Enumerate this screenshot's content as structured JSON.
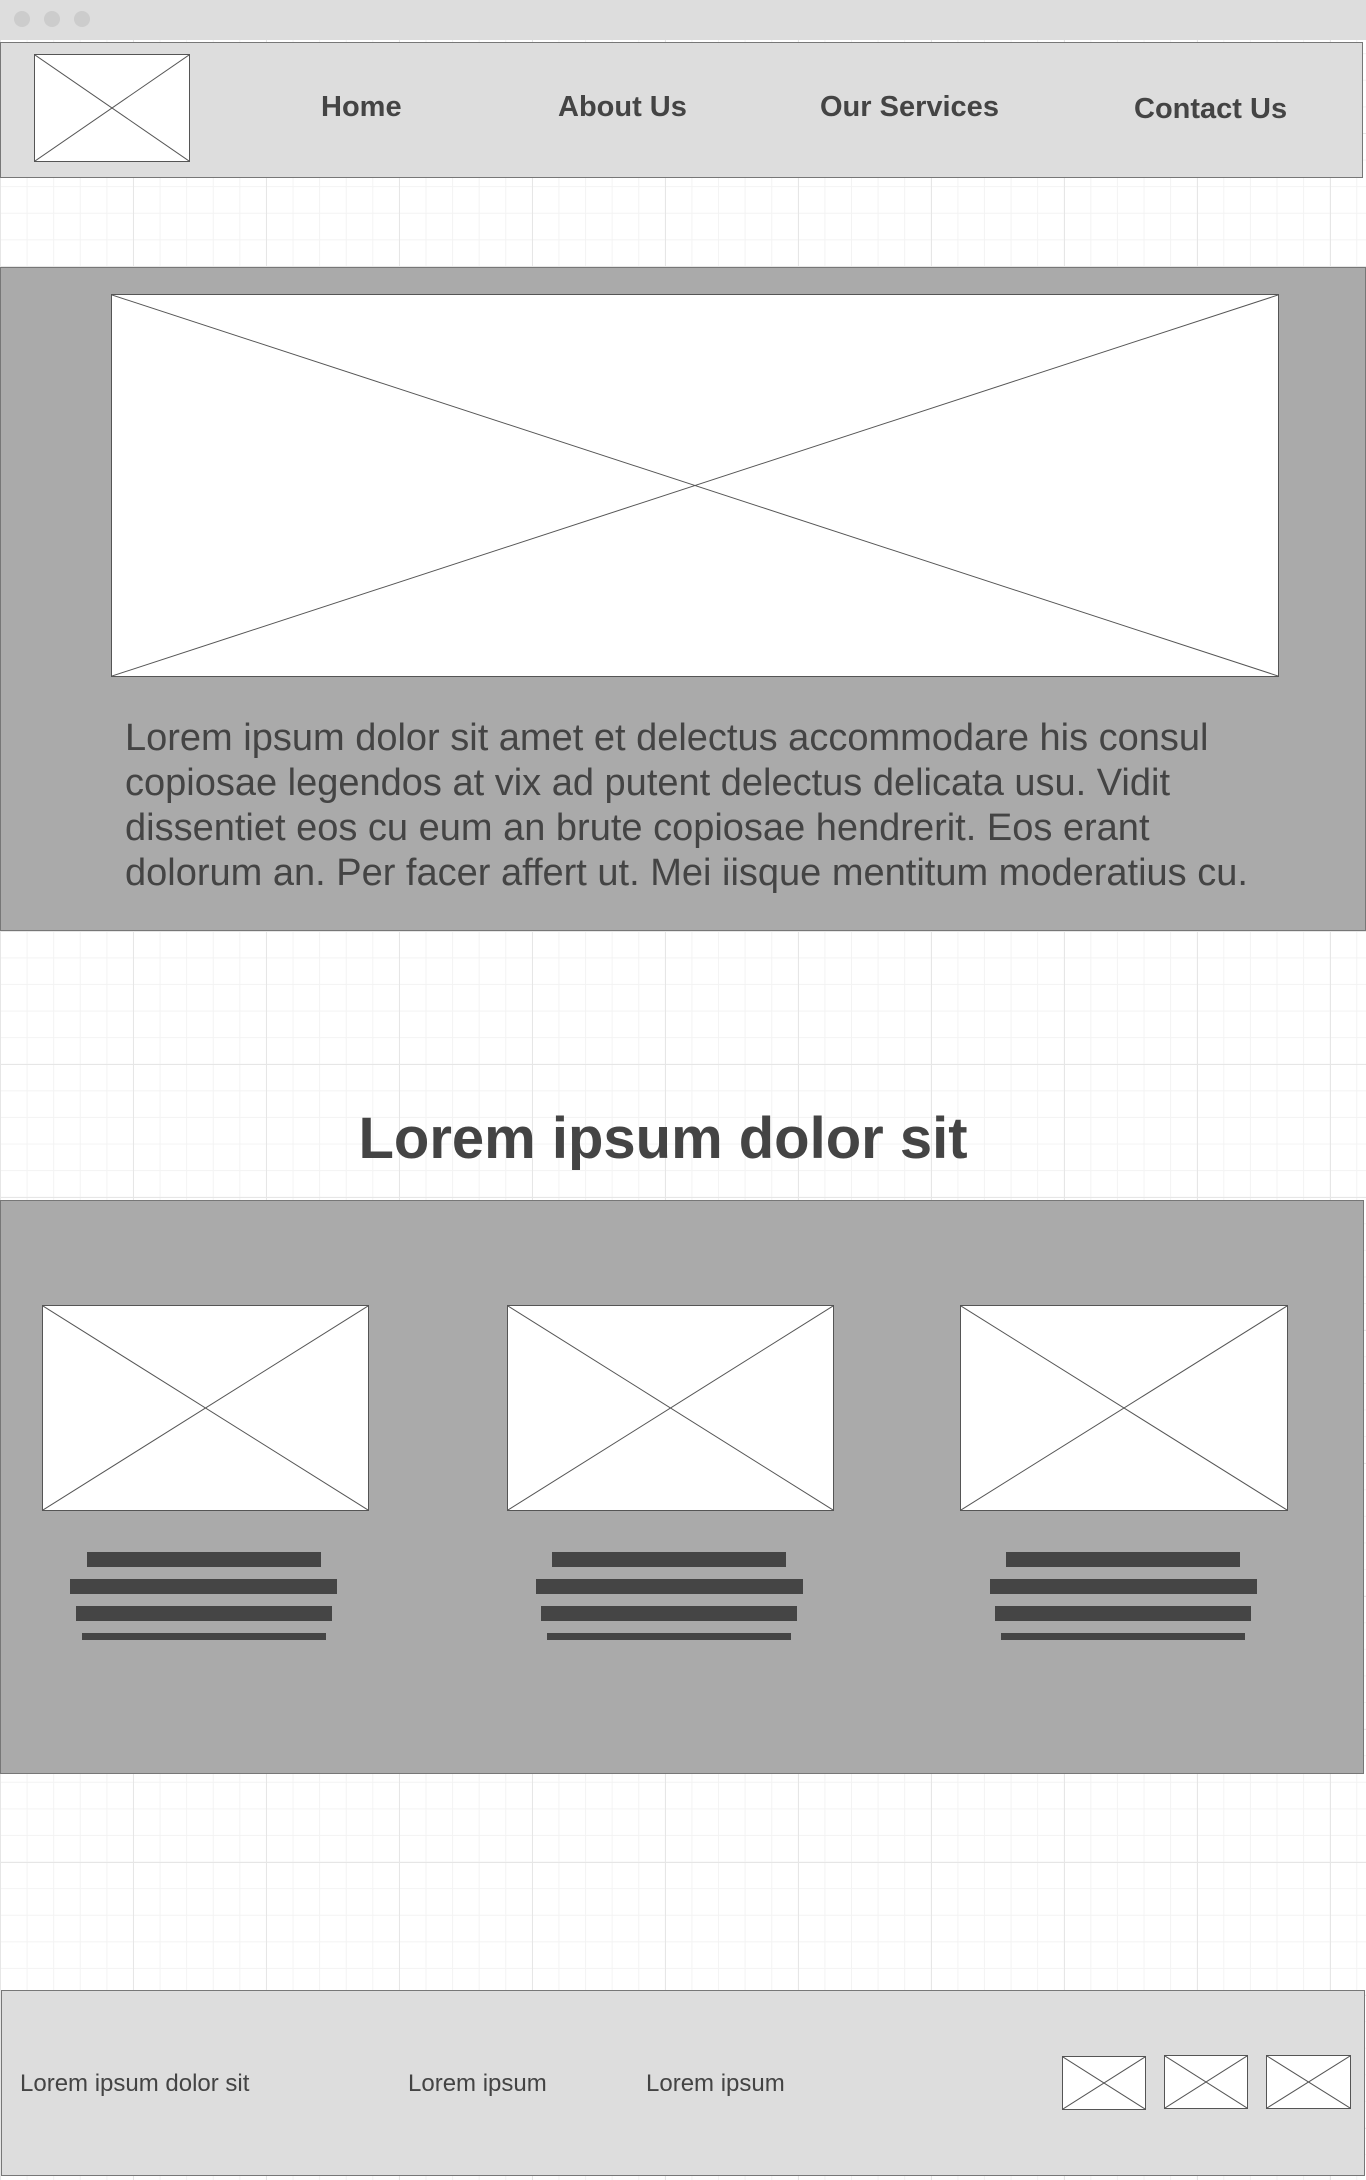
{
  "nav": {
    "items": [
      {
        "label": "Home"
      },
      {
        "label": "About Us"
      },
      {
        "label": "Our Services"
      },
      {
        "label": "Contact Us"
      }
    ]
  },
  "hero": {
    "text": "Lorem ipsum dolor sit amet et delectus accommodare his consul copiosae legendos at vix ad putent delectus delicata usu. Vidit dissentiet eos cu eum an brute copiosae hendrerit. Eos erant dolorum an. Per facer affert ut. Mei iisque mentitum moderatius cu."
  },
  "features": {
    "heading": "Lorem ipsum dolor sit",
    "cards": [
      {
        "image": "placeholder-image"
      },
      {
        "image": "placeholder-image"
      },
      {
        "image": "placeholder-image"
      }
    ]
  },
  "footer": {
    "texts": [
      "Lorem ipsum dolor sit",
      "Lorem ipsum",
      "Lorem ipsum"
    ],
    "icons": [
      "placeholder-icon",
      "placeholder-icon",
      "placeholder-icon"
    ]
  },
  "colors": {
    "chrome": "#dddddd",
    "band": "#aaaaaa",
    "text": "#444444",
    "placeholder_fill": "#ffffff"
  }
}
